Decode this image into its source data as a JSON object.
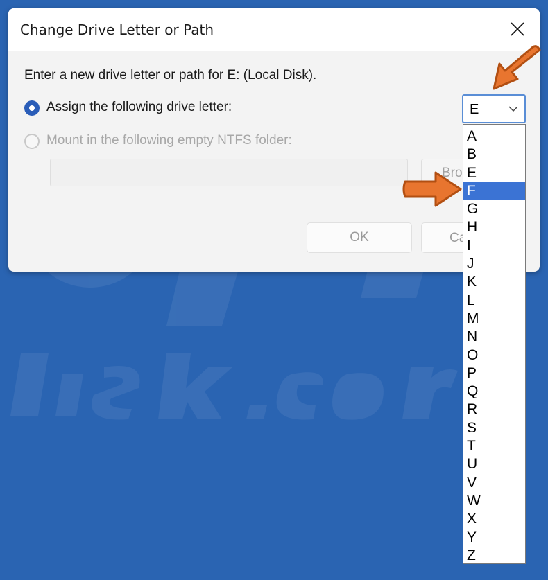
{
  "dialog": {
    "title": "Change Drive Letter or Path",
    "prompt": "Enter a new drive letter or path for E: (Local Disk).",
    "option_assign_label": "Assign the following drive letter:",
    "option_mount_label": "Mount in the following empty NTFS folder:",
    "folder_path_value": "",
    "browse_label": "Bro",
    "ok_label": "OK",
    "cancel_label": "Ca"
  },
  "drive_select": {
    "selected_value": "E",
    "options": [
      "A",
      "B",
      "E",
      "F",
      "G",
      "H",
      "I",
      "J",
      "K",
      "L",
      "M",
      "N",
      "O",
      "P",
      "Q",
      "R",
      "S",
      "T",
      "U",
      "V",
      "W",
      "X",
      "Y",
      "Z"
    ],
    "highlighted": "F"
  },
  "colors": {
    "background": "#2a64b2",
    "accent": "#2a5db8",
    "highlight": "#3b73d4",
    "arrow": "#e8752f"
  },
  "icons": {
    "close": "close-icon",
    "chevron": "chevron-down-icon",
    "pointer_arrow": "arrow-pointer-icon"
  }
}
